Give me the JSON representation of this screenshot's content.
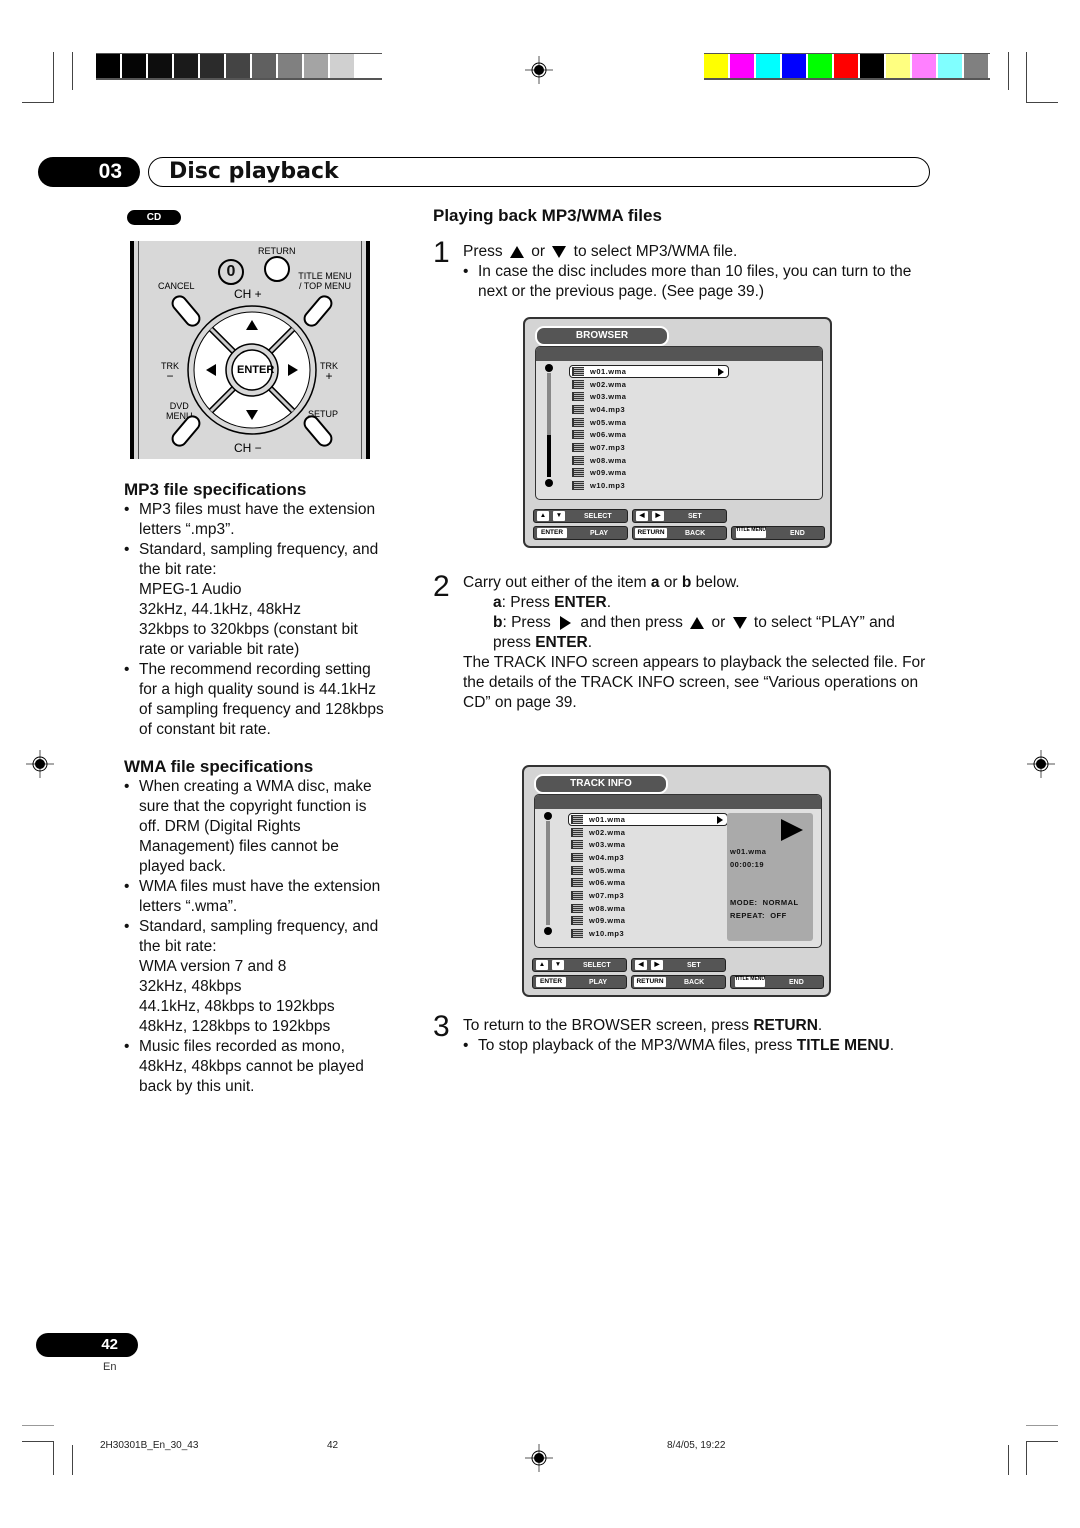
{
  "chapter": {
    "number": "03",
    "title": "Disc playback"
  },
  "disc_badge": "CD",
  "remote": {
    "labels": {
      "return": "RETURN",
      "zero": "0",
      "title_menu": "TITLE MENU",
      "top_menu": "/ TOP MENU",
      "cancel": "CANCEL",
      "ch_plus": "CH +",
      "ch_minus": "CH −",
      "trk_minus": "TRK",
      "trk_minus_sign": "−",
      "trk_plus": "TRK",
      "trk_plus_sign": "+",
      "enter": "ENTER",
      "dvd_menu_1": "DVD",
      "dvd_menu_2": "MENU",
      "setup": "SETUP"
    }
  },
  "mp3_spec": {
    "heading": "MP3 file specifications",
    "items": [
      {
        "bullet": true,
        "text": "MP3 files must have the extension letters “.mp3”."
      },
      {
        "bullet": true,
        "text": "Standard, sampling frequency, and the bit rate:"
      },
      {
        "bullet": false,
        "text": "MPEG-1 Audio"
      },
      {
        "bullet": false,
        "text": "32kHz, 44.1kHz, 48kHz"
      },
      {
        "bullet": false,
        "text": "32kbps to 320kbps (constant bit rate or variable bit rate)"
      },
      {
        "bullet": true,
        "text": "The recommend recording setting for a high quality sound is 44.1kHz of sampling frequency and 128kbps of constant bit rate."
      }
    ]
  },
  "wma_spec": {
    "heading": "WMA file specifications",
    "items": [
      {
        "bullet": true,
        "text": "When creating a WMA disc, make sure that the copyright function is off. DRM (Digital Rights Management) files cannot be played back."
      },
      {
        "bullet": true,
        "text": "WMA files must have the extension letters “.wma”."
      },
      {
        "bullet": true,
        "text": "Standard, sampling frequency, and the bit rate:"
      },
      {
        "bullet": false,
        "text": "WMA version 7 and 8"
      },
      {
        "bullet": false,
        "text": "32kHz, 48kbps"
      },
      {
        "bullet": false,
        "text": "44.1kHz, 48kbps to 192kbps"
      },
      {
        "bullet": false,
        "text": "48kHz, 128kbps to 192kbps"
      },
      {
        "bullet": true,
        "text": "Music files recorded as mono, 48kHz, 48kbps cannot be played back by this unit."
      }
    ]
  },
  "playback": {
    "heading": "Playing back MP3/WMA files",
    "step1": {
      "num": "1",
      "pre": "Press",
      "or": "or",
      "post": "to select MP3/WMA file.",
      "note": "In case the disc includes more than 10 files, you can turn to the next or the previous page. (See page 39.)"
    },
    "step2": {
      "num": "2",
      "line_pre": "Carry out either of the item",
      "a": "a",
      "or": "or",
      "b": "b",
      "line_post": "below.",
      "a_label": "a",
      "a_text": ": Press",
      "a_key": "ENTER",
      "b_label": "b",
      "b_text1": ": Press",
      "b_text2": "and then press",
      "b_or": "or",
      "b_text3": "to select “PLAY” and press",
      "b_key": "ENTER",
      "para": "The TRACK INFO screen appears to playback the selected file. For the details of the TRACK INFO screen, see “Various operations on CD” on page 39."
    },
    "step3": {
      "num": "3",
      "pre": "To return to the BROWSER screen, press",
      "key": "RETURN",
      "note_pre": "To stop playback of the MP3/WMA files, press",
      "note_key": "TITLE MENU"
    }
  },
  "browser_screen": {
    "title": "BROWSER",
    "files": [
      "w01.wma",
      "w02.wma",
      "w03.wma",
      "w04.mp3",
      "w05.wma",
      "w06.wma",
      "w07.mp3",
      "w08.wma",
      "w09.wma",
      "w10.mp3"
    ],
    "selected_index": 0,
    "footer": {
      "select": "SELECT",
      "set": "SET",
      "enter_key": "ENTER",
      "play": "PLAY",
      "return_key": "RETURN",
      "back": "BACK",
      "title_menu_key": "TITLE MENU",
      "end": "END"
    }
  },
  "track_info_screen": {
    "title": "TRACK INFO",
    "files": [
      "w01.wma",
      "w02.wma",
      "w03.wma",
      "w04.mp3",
      "w05.wma",
      "w06.wma",
      "w07.mp3",
      "w08.wma",
      "w09.wma",
      "w10.mp3"
    ],
    "selected_index": 0,
    "now_playing": "w01.wma",
    "elapsed": "00:00:19",
    "mode": "MODE:  NORMAL",
    "repeat": "REPEAT:  OFF",
    "footer": {
      "select": "SELECT",
      "set": "SET",
      "enter_key": "ENTER",
      "play": "PLAY",
      "return_key": "RETURN",
      "back": "BACK",
      "title_menu_key": "TITLE MENU",
      "end": "END"
    }
  },
  "page": {
    "number": "42",
    "lang": "En"
  },
  "print_footer": {
    "file": "2H30301B_En_30_43",
    "page": "42",
    "timestamp": "8/4/05, 19:22"
  },
  "color_bars": {
    "gray": [
      "#000000",
      "#050505",
      "#0d0d0d",
      "#1a1a1a",
      "#2b2b2b",
      "#444444",
      "#606060",
      "#808080",
      "#a4a4a4",
      "#d0d0d0",
      "#ffffff"
    ],
    "color": [
      "#ffff00",
      "#ff00ff",
      "#00ffff",
      "#0000ff",
      "#00ff00",
      "#ff0000",
      "#000000",
      "#ffff80",
      "#ff80ff",
      "#80ffff",
      "#808080"
    ]
  }
}
